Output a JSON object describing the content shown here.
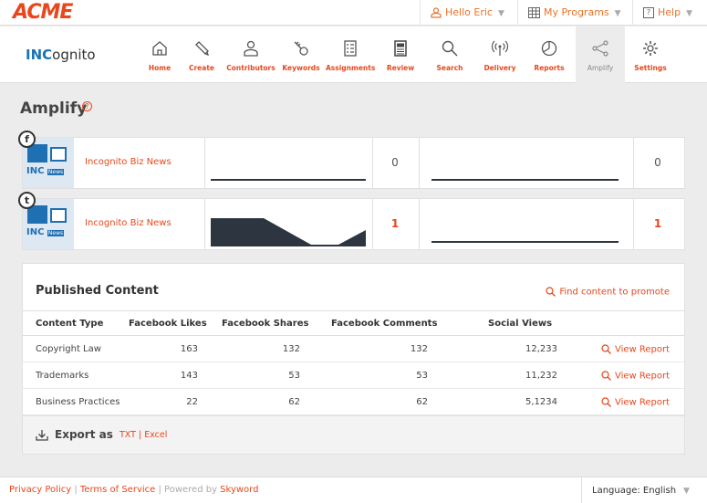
{
  "topbar": {
    "logo": "ACME",
    "user": "Hello Eric",
    "programs": "My Programs",
    "help": "Help"
  },
  "nav": {
    "brand_bold": "INC",
    "brand_rest": "ognito",
    "items": [
      {
        "label": "Home",
        "icon": "home-icon"
      },
      {
        "label": "Create",
        "icon": "pencil-icon"
      },
      {
        "label": "Contributors",
        "icon": "person-icon"
      },
      {
        "label": "Keywords",
        "icon": "key-icon"
      },
      {
        "label": "Assignments",
        "icon": "checklist-icon"
      },
      {
        "label": "Review",
        "icon": "document-icon"
      },
      {
        "label": "Search",
        "icon": "search-icon"
      },
      {
        "label": "Delivery",
        "icon": "broadcast-icon"
      },
      {
        "label": "Reports",
        "icon": "pie-chart-icon"
      },
      {
        "label": "Amplify",
        "icon": "share-icon"
      },
      {
        "label": "Settings",
        "icon": "gear-icon"
      }
    ],
    "active": "Amplify"
  },
  "page": {
    "title": "Amplify",
    "help_icon": "question-icon"
  },
  "channels": [
    {
      "network": "facebook",
      "network_glyph": "f",
      "name": "Incognito Biz News",
      "thumb_text": "INC",
      "thumb_badge": "News",
      "count1": "0",
      "count2": "0",
      "highlight": false
    },
    {
      "network": "twitter",
      "network_glyph": "t",
      "name": "Incognito Biz News",
      "thumb_text": "INC",
      "thumb_badge": "News",
      "count1": "1",
      "count2": "1",
      "highlight": true
    }
  ],
  "published": {
    "title": "Published Content",
    "find_link": "Find content to promote",
    "columns": [
      "Content Type",
      "Facebook Likes",
      "Facebook Shares",
      "Facebook Comments",
      "Social Views"
    ],
    "rows": [
      {
        "type": "Copyright Law",
        "likes": "163",
        "shares": "132",
        "comments": "132",
        "views": "12,233",
        "action": "View Report"
      },
      {
        "type": "Trademarks",
        "likes": "143",
        "shares": "53",
        "comments": "53",
        "views": "11,232",
        "action": "View Report"
      },
      {
        "type": "Business Practices",
        "likes": "22",
        "shares": "62",
        "comments": "62",
        "views": "5,1234",
        "action": "View Report"
      }
    ],
    "export_label": "Export as",
    "export_txt": "TXT",
    "export_sep": "|",
    "export_excel": "Excel"
  },
  "footer": {
    "privacy": "Privacy Policy",
    "sep1": " | ",
    "terms": "Terms of Service",
    "sep2": " | Powered by ",
    "brand": "Skyword",
    "language_label": "Language:",
    "language_value": "English"
  },
  "colors": {
    "accent": "#e8471c",
    "brand_blue": "#1a74b3",
    "background": "#ececec"
  }
}
